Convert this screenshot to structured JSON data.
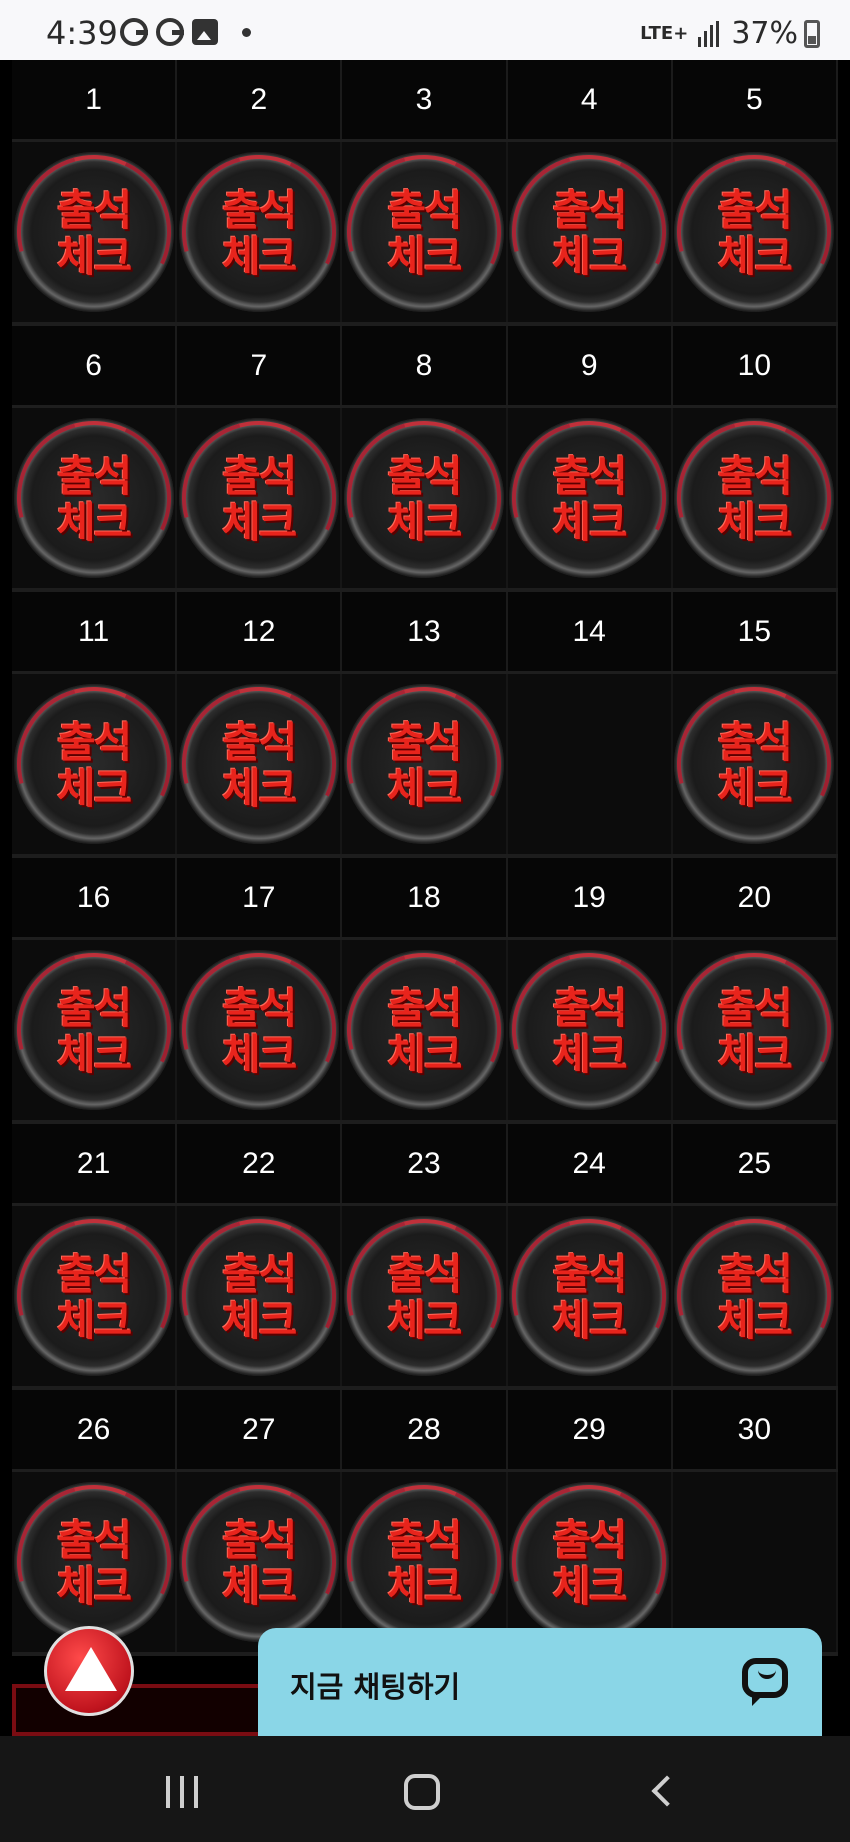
{
  "status_bar": {
    "time": "4:39",
    "network": "LTE+",
    "battery": "37%"
  },
  "calendar": {
    "stamp_text_line1": "출석",
    "stamp_text_line2": "체크",
    "weeks": [
      {
        "days": [
          "1",
          "2",
          "3",
          "4",
          "5"
        ],
        "stamped": [
          true,
          true,
          true,
          true,
          true
        ]
      },
      {
        "days": [
          "6",
          "7",
          "8",
          "9",
          "10"
        ],
        "stamped": [
          true,
          true,
          true,
          true,
          true
        ]
      },
      {
        "days": [
          "11",
          "12",
          "13",
          "14",
          "15"
        ],
        "stamped": [
          true,
          true,
          true,
          false,
          true
        ]
      },
      {
        "days": [
          "16",
          "17",
          "18",
          "19",
          "20"
        ],
        "stamped": [
          true,
          true,
          true,
          true,
          true
        ]
      },
      {
        "days": [
          "21",
          "22",
          "23",
          "24",
          "25"
        ],
        "stamped": [
          true,
          true,
          true,
          true,
          true
        ]
      },
      {
        "days": [
          "26",
          "27",
          "28",
          "29",
          "30"
        ],
        "stamped": [
          true,
          true,
          true,
          true,
          false
        ]
      }
    ]
  },
  "chat": {
    "label": "지금 채팅하기"
  },
  "colors": {
    "chat_background": "#8ad6e7",
    "stamp_red": "#e8241c",
    "top_button_red": "#c0141e"
  }
}
